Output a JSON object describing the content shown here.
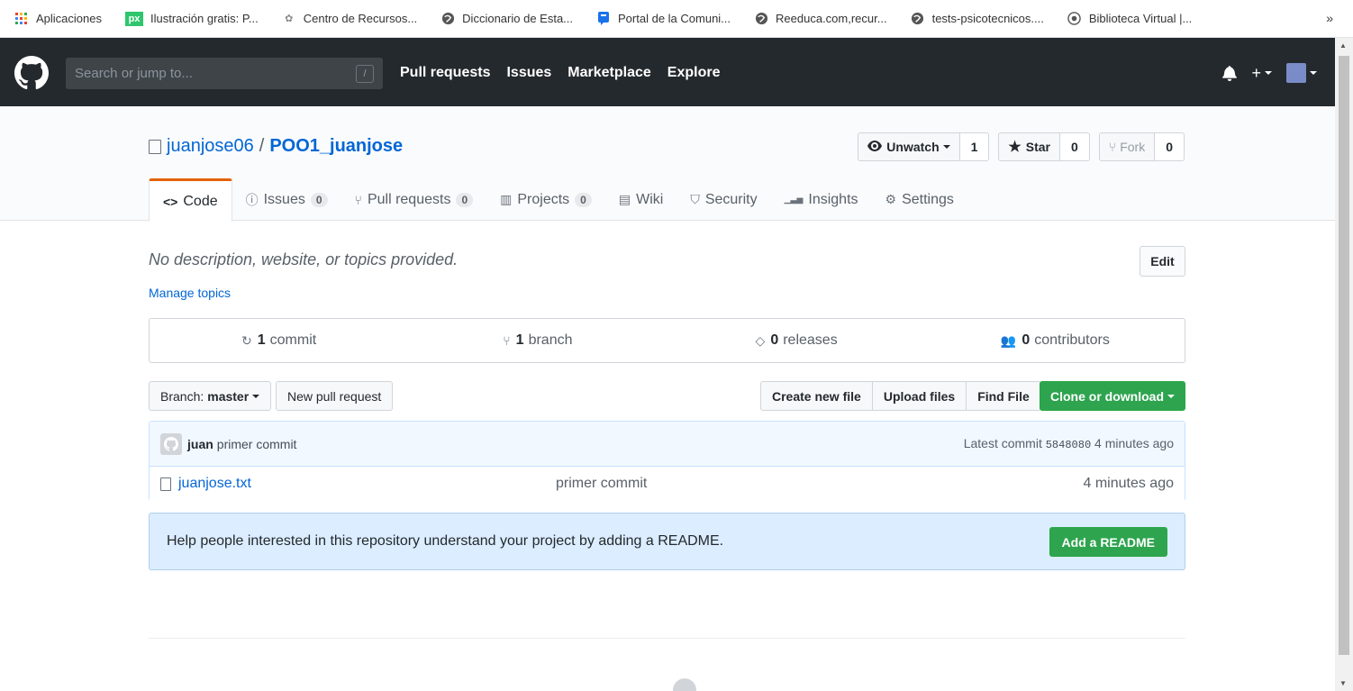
{
  "bookmarks": [
    {
      "label": "Aplicaciones",
      "icon": "apps-grid-icon",
      "color": "#e94235"
    },
    {
      "label": "Ilustración gratis: P...",
      "icon": "pixabay-icon",
      "color": "#2ec66d"
    },
    {
      "label": "Centro de Recursos...",
      "icon": "resources-icon",
      "color": "#888888"
    },
    {
      "label": "Diccionario de Esta...",
      "icon": "globe-icon",
      "color": "#555555"
    },
    {
      "label": "Portal de la Comuni...",
      "icon": "portal-icon",
      "color": "#1a73e8"
    },
    {
      "label": "Reeduca.com,recur...",
      "icon": "globe-icon",
      "color": "#555555"
    },
    {
      "label": "tests-psicotecnicos....",
      "icon": "globe-icon",
      "color": "#555555"
    },
    {
      "label": "Biblioteca Virtual |...",
      "icon": "library-icon",
      "color": "#555555"
    }
  ],
  "bookmarks_more": "»",
  "header": {
    "search_placeholder": "Search or jump to...",
    "search_shortcut": "/",
    "nav": [
      "Pull requests",
      "Issues",
      "Marketplace",
      "Explore"
    ],
    "new_label": "+"
  },
  "repo": {
    "owner": "juanjose06",
    "separator": "/",
    "name": "POO1_juanjose",
    "watch_label": "Unwatch",
    "watch_count": "1",
    "star_label": "Star",
    "star_count": "0",
    "fork_label": "Fork",
    "fork_count": "0"
  },
  "tabs": [
    {
      "label": "Code",
      "icon": "<>",
      "counter": null,
      "selected": true
    },
    {
      "label": "Issues",
      "icon": "ⓘ",
      "counter": "0"
    },
    {
      "label": "Pull requests",
      "icon": "⑂",
      "counter": "0"
    },
    {
      "label": "Projects",
      "icon": "▥",
      "counter": "0"
    },
    {
      "label": "Wiki",
      "icon": "▤",
      "counter": null
    },
    {
      "label": "Security",
      "icon": "⛉",
      "counter": null
    },
    {
      "label": "Insights",
      "icon": "▁▃▅",
      "counter": null
    },
    {
      "label": "Settings",
      "icon": "⚙",
      "counter": null
    }
  ],
  "main": {
    "description": "No description, website, or topics provided.",
    "edit_label": "Edit",
    "manage_topics": "Manage topics"
  },
  "summary": [
    {
      "icon": "↻",
      "count": "1",
      "label": "commit"
    },
    {
      "icon": "⑂",
      "count": "1",
      "label": "branch"
    },
    {
      "icon": "◇",
      "count": "0",
      "label": "releases"
    },
    {
      "icon": "👥",
      "count": "0",
      "label": "contributors"
    }
  ],
  "filenav": {
    "branch_prefix": "Branch:",
    "branch_name": "master",
    "new_pr": "New pull request",
    "create_file": "Create new file",
    "upload_files": "Upload files",
    "find_file": "Find File",
    "clone": "Clone or download"
  },
  "commit": {
    "author": "juan",
    "message": "primer commit",
    "latest_prefix": "Latest commit",
    "sha": "5848080",
    "age": "4 minutes ago"
  },
  "files": [
    {
      "name": "juanjose.txt",
      "message": "primer commit",
      "age": "4 minutes ago"
    }
  ],
  "readme": {
    "text": "Help people interested in this repository understand your project by adding a README.",
    "button": "Add a README"
  },
  "colors": {
    "header_bg": "#24292e",
    "link": "#0366d6",
    "green": "#2ea44f",
    "tab_accent": "#e36209"
  }
}
